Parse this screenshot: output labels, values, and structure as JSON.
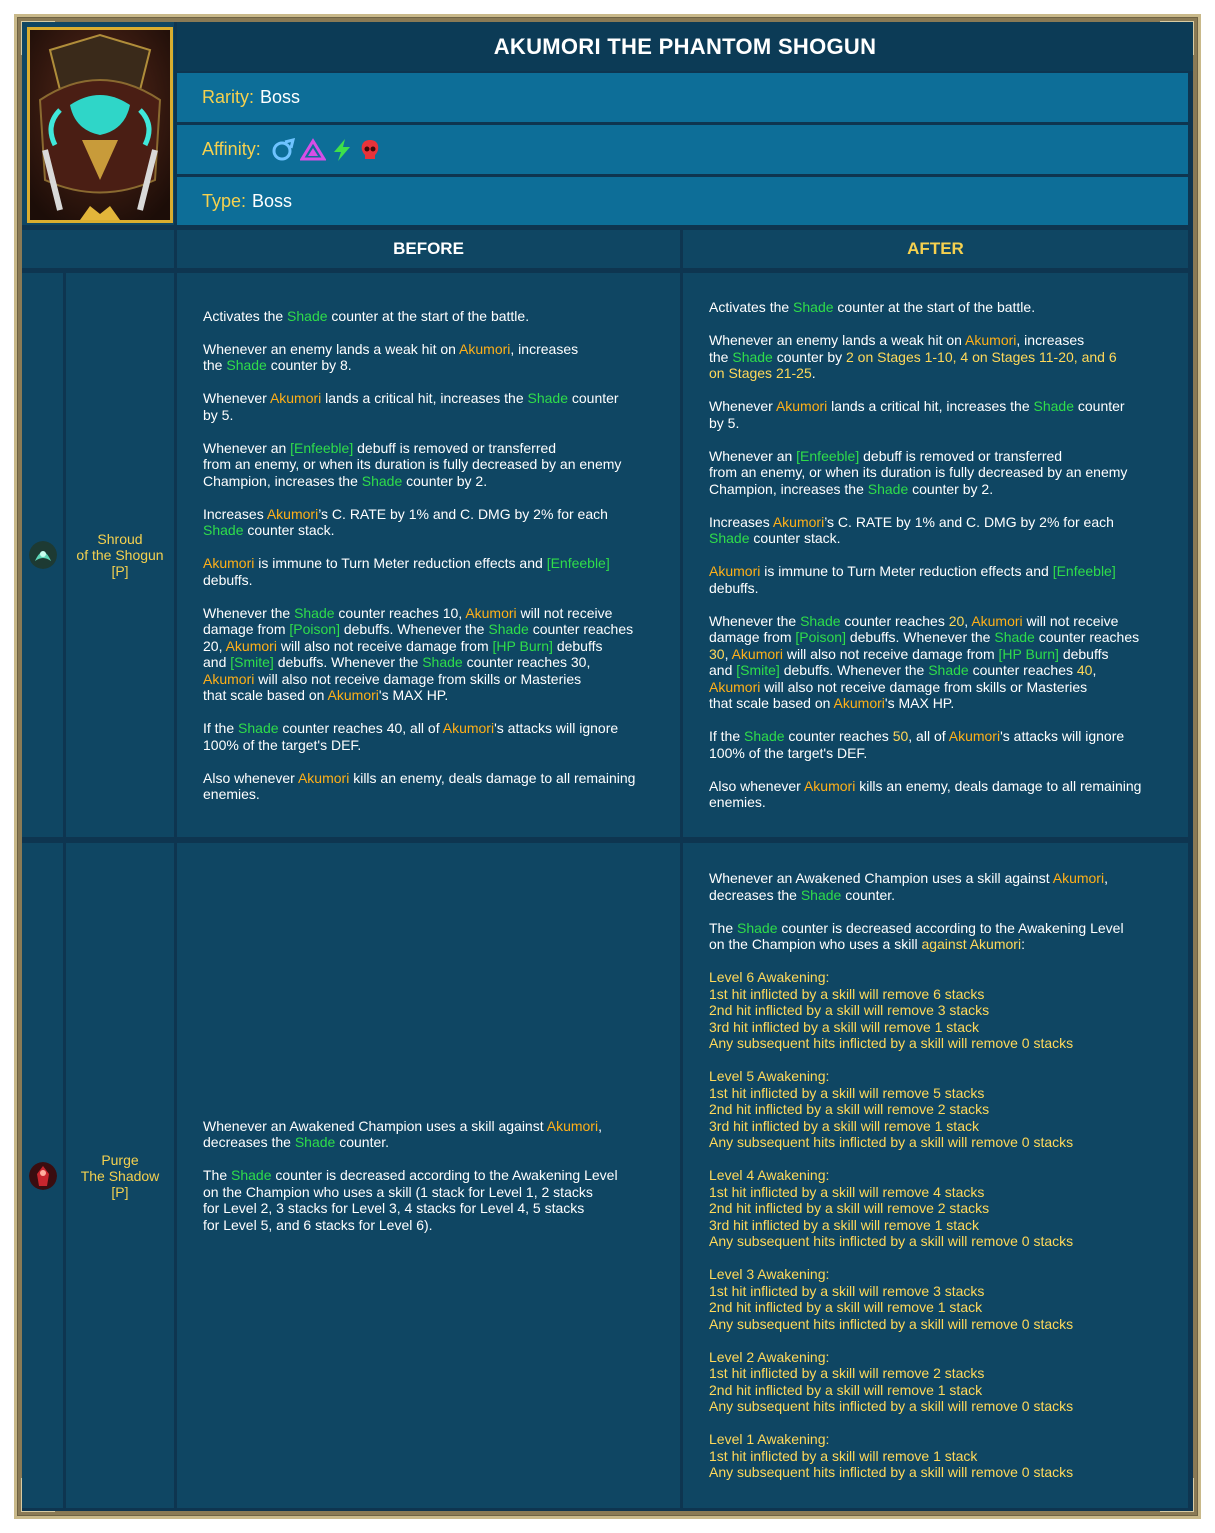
{
  "champion": {
    "title": "AKUMORI THE PHANTOM SHOGUN",
    "rarity_label": "Rarity:",
    "rarity_value": "Boss",
    "affinity_label": "Affinity:",
    "affinity_icons": [
      "magic-icon",
      "spirit-icon",
      "force-icon",
      "void-icon"
    ],
    "type_label": "Type:",
    "type_value": "Boss"
  },
  "columns": {
    "before": "BEFORE",
    "after": "AFTER"
  },
  "skills": [
    {
      "name_line1": "Shroud",
      "name_line2": "of the Shogun",
      "name_line3": "[P]",
      "icon": "shroud-skill-icon",
      "before": [
        [
          [
            "Activates the ",
            "w"
          ],
          [
            "Shade",
            "g"
          ],
          [
            " counter at the start of the battle.",
            "w"
          ]
        ],
        [
          [
            "Whenever an enemy lands a weak hit on ",
            "w"
          ],
          [
            "Akumori",
            "o"
          ],
          [
            ", increases\nthe ",
            "w"
          ],
          [
            "Shade",
            "g"
          ],
          [
            " counter by 8.",
            "w"
          ]
        ],
        [
          [
            "Whenever ",
            "w"
          ],
          [
            "Akumori",
            "o"
          ],
          [
            " lands a critical hit, increases the ",
            "w"
          ],
          [
            "Shade",
            "g"
          ],
          [
            " counter\nby 5.",
            "w"
          ]
        ],
        [
          [
            "Whenever an ",
            "w"
          ],
          [
            "[Enfeeble]",
            "g"
          ],
          [
            " debuff is removed or transferred\nfrom an enemy, or when its duration is fully decreased by an enemy\nChampion, increases the ",
            "w"
          ],
          [
            "Shade",
            "g"
          ],
          [
            " counter by 2.",
            "w"
          ]
        ],
        [
          [
            "Increases ",
            "w"
          ],
          [
            "Akumori",
            "o"
          ],
          [
            "’s C. RATE by 1% and C. DMG by 2% for each\n",
            "w"
          ],
          [
            "Shade",
            "g"
          ],
          [
            " counter stack.",
            "w"
          ]
        ],
        [
          [
            "Akumori",
            "o"
          ],
          [
            " is immune to Turn Meter reduction effects and ",
            "w"
          ],
          [
            "[Enfeeble]",
            "g"
          ],
          [
            "\ndebuffs.",
            "w"
          ]
        ],
        [
          [
            "Whenever the ",
            "w"
          ],
          [
            "Shade",
            "g"
          ],
          [
            " counter reaches 10, ",
            "w"
          ],
          [
            "Akumori",
            "o"
          ],
          [
            " will not receive\ndamage from ",
            "w"
          ],
          [
            "[Poison]",
            "g"
          ],
          [
            " debuffs. Whenever the ",
            "w"
          ],
          [
            "Shade",
            "g"
          ],
          [
            " counter reaches\n20, ",
            "w"
          ],
          [
            "Akumori",
            "o"
          ],
          [
            " will also not receive damage from ",
            "w"
          ],
          [
            "[HP Burn]",
            "g"
          ],
          [
            " debuffs\nand ",
            "w"
          ],
          [
            "[Smite]",
            "g"
          ],
          [
            " debuffs. Whenever the ",
            "w"
          ],
          [
            "Shade",
            "g"
          ],
          [
            " counter reaches 30,\n",
            "w"
          ],
          [
            "Akumori",
            "o"
          ],
          [
            " will also not receive damage from skills or Masteries\nthat scale based on ",
            "w"
          ],
          [
            "Akumori",
            "o"
          ],
          [
            "'s MAX HP.",
            "w"
          ]
        ],
        [
          [
            "If the ",
            "w"
          ],
          [
            "Shade",
            "g"
          ],
          [
            " counter reaches 40, all of ",
            "w"
          ],
          [
            "Akumori",
            "o"
          ],
          [
            "'s attacks will ignore\n100% of the target's DEF.",
            "w"
          ]
        ],
        [
          [
            "Also whenever ",
            "w"
          ],
          [
            "Akumori",
            "o"
          ],
          [
            " kills an enemy, deals damage to all remaining\nenemies.",
            "w"
          ]
        ]
      ],
      "after": [
        [
          [
            "Activates the ",
            "w"
          ],
          [
            "Shade",
            "g"
          ],
          [
            " counter at the start of the battle.",
            "w"
          ]
        ],
        [
          [
            "Whenever an enemy lands a weak hit on ",
            "w"
          ],
          [
            "Akumori",
            "o"
          ],
          [
            ", increases\nthe ",
            "w"
          ],
          [
            "Shade",
            "g"
          ],
          [
            " counter by ",
            "w"
          ],
          [
            "2 on Stages 1-10, 4 on Stages 11-20, and 6\non Stages 21-25",
            "y"
          ],
          [
            ".",
            "w"
          ]
        ],
        [
          [
            "Whenever ",
            "w"
          ],
          [
            "Akumori",
            "o"
          ],
          [
            " lands a critical hit, increases the ",
            "w"
          ],
          [
            "Shade",
            "g"
          ],
          [
            " counter\nby 5.",
            "w"
          ]
        ],
        [
          [
            "Whenever an ",
            "w"
          ],
          [
            "[Enfeeble]",
            "g"
          ],
          [
            " debuff is removed or transferred\nfrom an enemy, or when its duration is fully decreased by an enemy\nChampion, increases the ",
            "w"
          ],
          [
            "Shade",
            "g"
          ],
          [
            " counter by 2.",
            "w"
          ]
        ],
        [
          [
            "Increases ",
            "w"
          ],
          [
            "Akumori",
            "o"
          ],
          [
            "’s C. RATE by 1% and C. DMG by 2% for each\n",
            "w"
          ],
          [
            "Shade",
            "g"
          ],
          [
            " counter stack.",
            "w"
          ]
        ],
        [
          [
            "Akumori",
            "o"
          ],
          [
            " is immune to Turn Meter reduction effects and ",
            "w"
          ],
          [
            "[Enfeeble]",
            "g"
          ],
          [
            "\ndebuffs.",
            "w"
          ]
        ],
        [
          [
            "Whenever the ",
            "w"
          ],
          [
            "Shade",
            "g"
          ],
          [
            " counter reaches ",
            "w"
          ],
          [
            "20",
            "y"
          ],
          [
            ", ",
            "w"
          ],
          [
            "Akumori",
            "o"
          ],
          [
            " will not receive\ndamage from ",
            "w"
          ],
          [
            "[Poison]",
            "g"
          ],
          [
            " debuffs. Whenever the ",
            "w"
          ],
          [
            "Shade",
            "g"
          ],
          [
            " counter reaches\n",
            "w"
          ],
          [
            "30",
            "y"
          ],
          [
            ", ",
            "w"
          ],
          [
            "Akumori",
            "o"
          ],
          [
            " will also not receive damage from ",
            "w"
          ],
          [
            "[HP Burn]",
            "g"
          ],
          [
            " debuffs\nand ",
            "w"
          ],
          [
            "[Smite]",
            "g"
          ],
          [
            " debuffs. Whenever the ",
            "w"
          ],
          [
            "Shade",
            "g"
          ],
          [
            " counter reaches ",
            "w"
          ],
          [
            "40",
            "y"
          ],
          [
            ",\n",
            "w"
          ],
          [
            "Akumori",
            "o"
          ],
          [
            " will also not receive damage from skills or Masteries\nthat scale based on ",
            "w"
          ],
          [
            "Akumori",
            "o"
          ],
          [
            "'s MAX HP.",
            "w"
          ]
        ],
        [
          [
            "If the ",
            "w"
          ],
          [
            "Shade",
            "g"
          ],
          [
            " counter reaches ",
            "w"
          ],
          [
            "50",
            "y"
          ],
          [
            ", all of ",
            "w"
          ],
          [
            "Akumori",
            "o"
          ],
          [
            "'s attacks will ignore\n100% of the target's DEF.",
            "w"
          ]
        ],
        [
          [
            "Also whenever ",
            "w"
          ],
          [
            "Akumori",
            "o"
          ],
          [
            " kills an enemy, deals damage to all remaining\nenemies.",
            "w"
          ]
        ]
      ]
    },
    {
      "name_line1": "Purge",
      "name_line2": "The Shadow",
      "name_line3": "[P]",
      "icon": "purge-skill-icon",
      "before": [
        [
          [
            "Whenever an Awakened Champion uses a skill against ",
            "w"
          ],
          [
            "Akumori",
            "o"
          ],
          [
            ",\ndecreases the ",
            "w"
          ],
          [
            "Shade",
            "g"
          ],
          [
            " counter.",
            "w"
          ]
        ],
        [
          [
            "The ",
            "w"
          ],
          [
            "Shade",
            "g"
          ],
          [
            " counter is decreased according to the Awakening Level\non the Champion who uses a skill (1 stack for Level 1, 2 stacks\nfor Level 2, 3 stacks for Level 3, 4 stacks for Level 4, 5 stacks\nfor Level 5, and 6 stacks for Level 6).",
            "w"
          ]
        ]
      ],
      "after": [
        [
          [
            "Whenever an Awakened Champion uses a skill against ",
            "w"
          ],
          [
            "Akumori",
            "o"
          ],
          [
            ",\ndecreases the ",
            "w"
          ],
          [
            "Shade",
            "g"
          ],
          [
            " counter.",
            "w"
          ]
        ],
        [
          [
            "The ",
            "w"
          ],
          [
            "Shade",
            "g"
          ],
          [
            " counter is decreased according to the Awakening Level\non the Champion who uses a skill ",
            "w"
          ],
          [
            "against Akumori",
            "y"
          ],
          [
            ":",
            "w"
          ]
        ],
        [
          [
            "Level 6 Awakening:\n1st hit inflicted by a skill will remove 6 stacks\n2nd hit inflicted by a skill will remove 3 stacks\n3rd hit inflicted by a skill will remove 1 stack\nAny subsequent hits inflicted by a skill will remove 0 stacks",
            "y"
          ]
        ],
        [
          [
            "Level 5 Awakening:\n1st hit inflicted by a skill will remove 5 stacks\n2nd hit inflicted by a skill will remove 2 stacks\n3rd hit inflicted by a skill will remove 1 stack\nAny subsequent hits inflicted by a skill will remove 0 stacks",
            "y"
          ]
        ],
        [
          [
            "Level 4 Awakening:\n1st hit inflicted by a skill will remove 4 stacks\n2nd hit inflicted by a skill will remove 2 stacks\n3rd hit inflicted by a skill will remove 1 stack\nAny subsequent hits inflicted by a skill will remove 0 stacks",
            "y"
          ]
        ],
        [
          [
            "Level 3 Awakening:\n1st hit inflicted by a skill will remove 3 stacks\n2nd hit inflicted by a skill will remove 1 stack\nAny subsequent hits inflicted by a skill will remove 0 stacks",
            "y"
          ]
        ],
        [
          [
            "Level 2 Awakening:\n1st hit inflicted by a skill will remove 2 stacks\n2nd hit inflicted by a skill will remove 1 stack\nAny subsequent hits inflicted by a skill will remove 0 stacks",
            "y"
          ]
        ],
        [
          [
            "Level 1 Awakening:\n1st hit inflicted by a skill will remove 1 stack\nAny subsequent hits inflicted by a skill will remove 0 stacks",
            "y"
          ]
        ]
      ]
    }
  ]
}
